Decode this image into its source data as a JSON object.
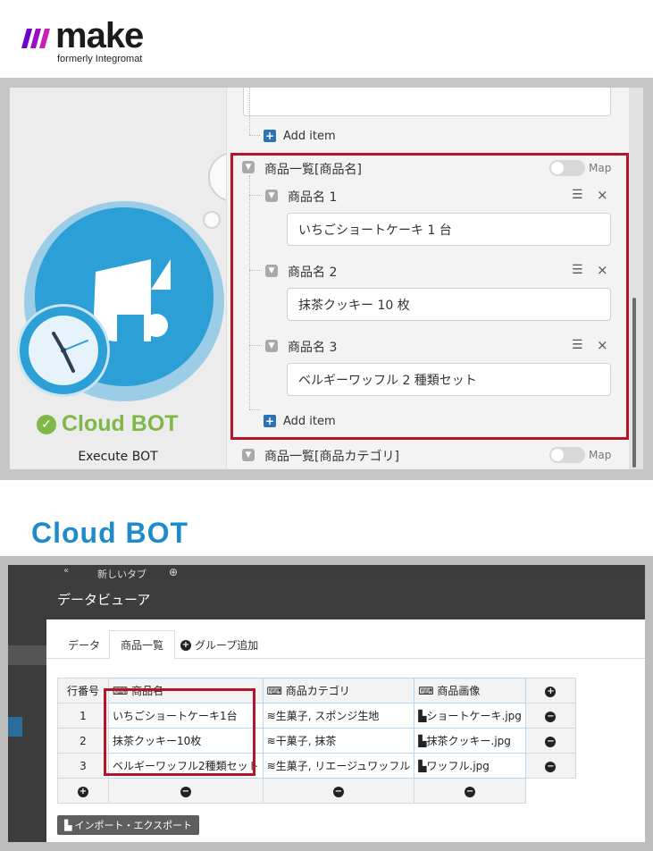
{
  "logo": {
    "word": "make",
    "subtitle": "formerly Integromat",
    "brand_colors": [
      "#6d00cc",
      "#c81fb4"
    ]
  },
  "module": {
    "name": "Cloud BOT",
    "action": "Execute BOT",
    "status_icon": "check-circle-icon",
    "accent": "#7fb848",
    "circle_color": "#2b9fd6"
  },
  "config": {
    "add_item": "Add item",
    "map_label": "Map",
    "section_title": "商品一覧[商品名]",
    "items": [
      {
        "label": "商品名 1",
        "value": "いちごショートケーキ 1 台"
      },
      {
        "label": "商品名 2",
        "value": "抹茶クッキー 10 枚"
      },
      {
        "label": "商品名 3",
        "value": "ベルギーワッフル 2 種類セット"
      }
    ],
    "next_section_title": "商品一覧[商品カテゴリ]",
    "highlight_color": "#b4152b"
  },
  "cloudbot_heading": "Cloud BOT",
  "viewer": {
    "side_tab": "新しいタブ",
    "title": "データビューア",
    "tabs": [
      {
        "label": "データ",
        "active": false
      },
      {
        "label": "商品一覧",
        "active": true
      },
      {
        "label": "グループ追加",
        "active": false
      }
    ],
    "columns": [
      "行番号",
      "商品名",
      "商品カテゴリ",
      "商品画像"
    ],
    "rows": [
      {
        "no": "1",
        "name": "いちごショートケーキ1台",
        "category": "生菓子, スポンジ生地",
        "image": "ショートケーキ.jpg"
      },
      {
        "no": "2",
        "name": "抹茶クッキー10枚",
        "category": "干菓子, 抹茶",
        "image": "抹茶クッキー.jpg"
      },
      {
        "no": "3",
        "name": "ベルギーワッフル2種類セット",
        "category": "生菓子, リエージュワッフル",
        "image": "ワッフル.jpg"
      }
    ],
    "import_export": "インポート・エクスポート"
  }
}
